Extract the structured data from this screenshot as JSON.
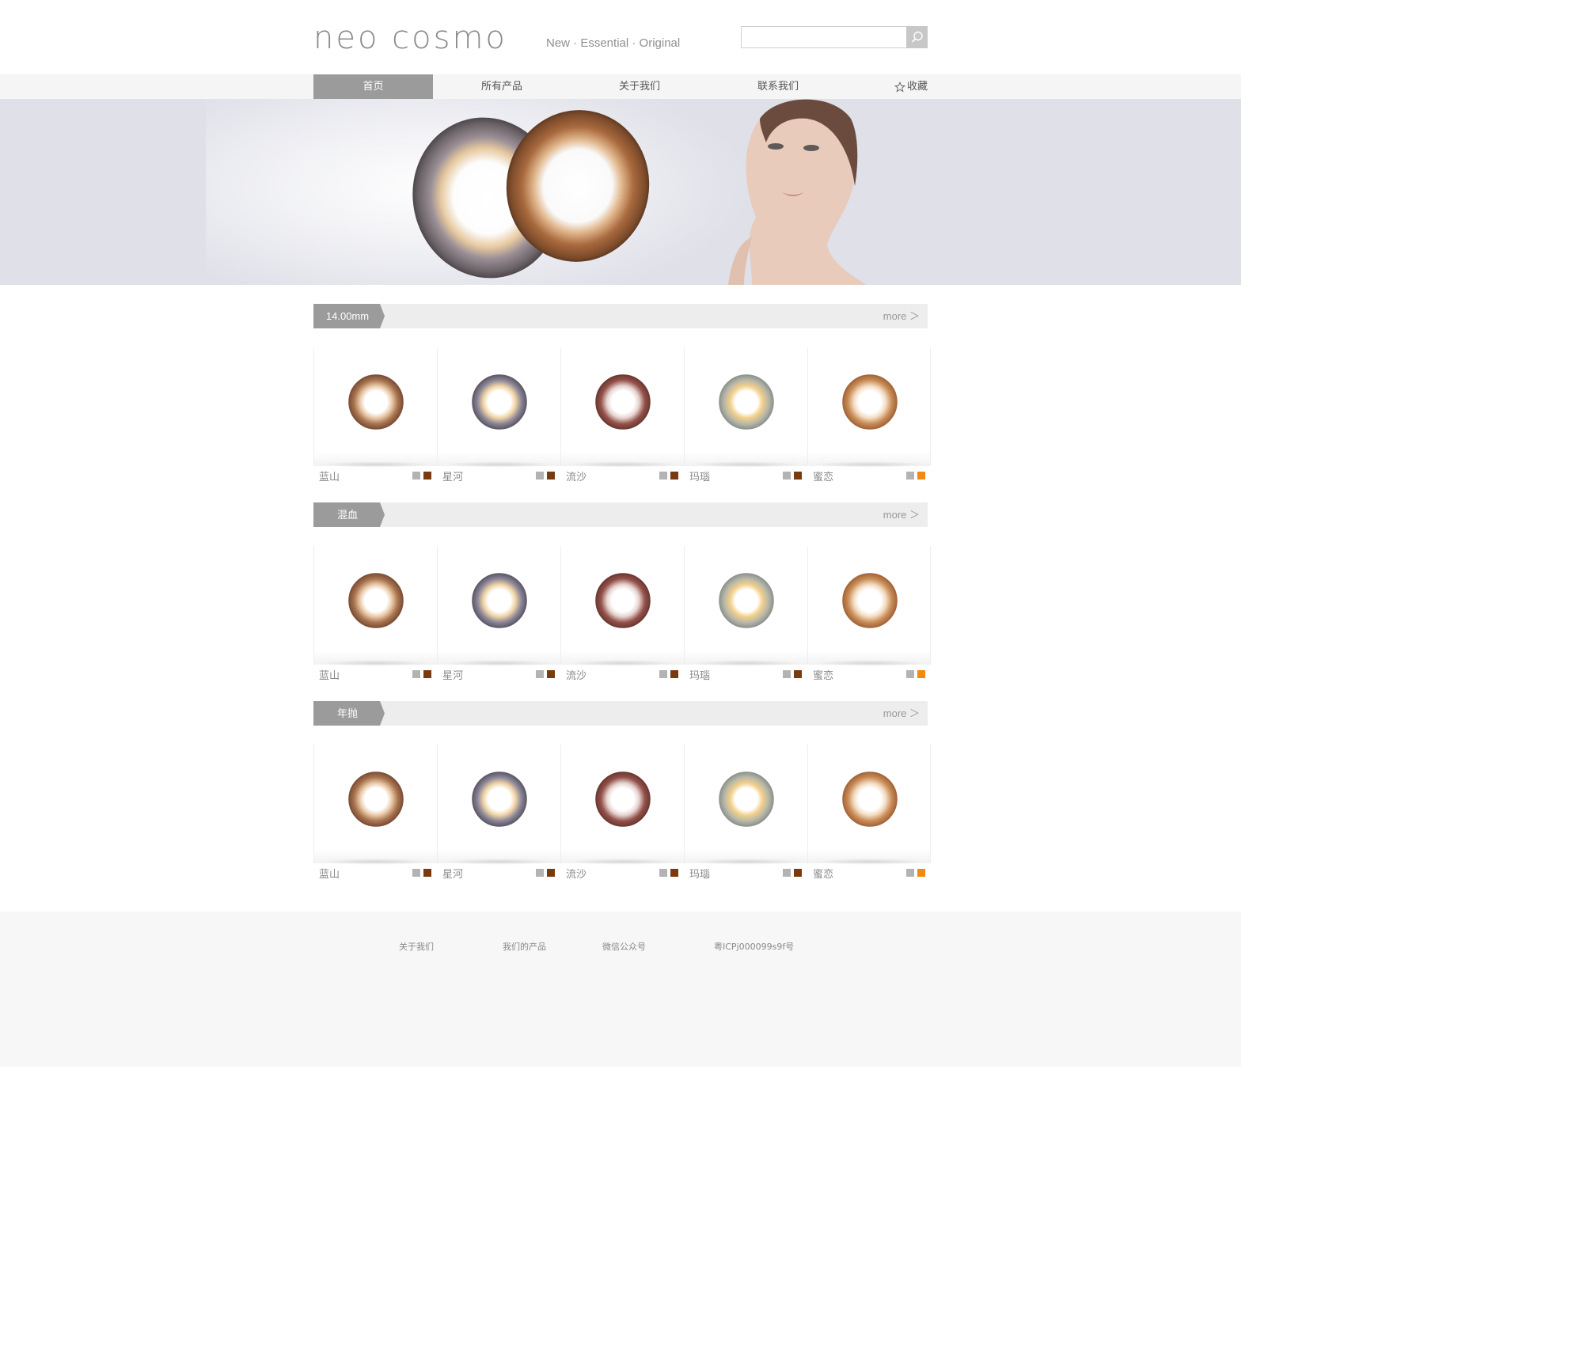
{
  "header": {
    "logo": "neo cosmo",
    "tagline": "New · Essential · Original",
    "search": {
      "value": "",
      "placeholder": ""
    }
  },
  "nav": {
    "items": [
      {
        "label": "首页",
        "active": true
      },
      {
        "label": "所有产品",
        "active": false
      },
      {
        "label": "关于我们",
        "active": false
      },
      {
        "label": "联系我们",
        "active": false
      }
    ],
    "favorite": "收藏"
  },
  "sections": [
    {
      "title": "14.00mm",
      "more": "more ＞",
      "products": [
        {
          "name": "蓝山",
          "swatches": [
            "#b3b3b3",
            "#7a3a10"
          ],
          "lens": "brown"
        },
        {
          "name": "星河",
          "swatches": [
            "#b3b3b3",
            "#7a3a10"
          ],
          "lens": "gray"
        },
        {
          "name": "流沙",
          "swatches": [
            "#b3b3b3",
            "#7a3a10"
          ],
          "lens": "darkbrown"
        },
        {
          "name": "玛瑙",
          "swatches": [
            "#b3b3b3",
            "#7a3a10"
          ],
          "lens": "hazel"
        },
        {
          "name": "蜜恋",
          "swatches": [
            "#b3b3b3",
            "#f08a10"
          ],
          "lens": "honey"
        }
      ]
    },
    {
      "title": "混血",
      "more": "more ＞",
      "products": [
        {
          "name": "蓝山",
          "swatches": [
            "#b3b3b3",
            "#7a3a10"
          ],
          "lens": "brown"
        },
        {
          "name": "星河",
          "swatches": [
            "#b3b3b3",
            "#7a3a10"
          ],
          "lens": "gray"
        },
        {
          "name": "流沙",
          "swatches": [
            "#b3b3b3",
            "#7a3a10"
          ],
          "lens": "darkbrown"
        },
        {
          "name": "玛瑙",
          "swatches": [
            "#b3b3b3",
            "#7a3a10"
          ],
          "lens": "hazel"
        },
        {
          "name": "蜜恋",
          "swatches": [
            "#b3b3b3",
            "#f08a10"
          ],
          "lens": "honey"
        }
      ]
    },
    {
      "title": "年抛",
      "more": "more ＞",
      "products": [
        {
          "name": "蓝山",
          "swatches": [
            "#b3b3b3",
            "#7a3a10"
          ],
          "lens": "brown"
        },
        {
          "name": "星河",
          "swatches": [
            "#b3b3b3",
            "#7a3a10"
          ],
          "lens": "gray"
        },
        {
          "name": "流沙",
          "swatches": [
            "#b3b3b3",
            "#7a3a10"
          ],
          "lens": "darkbrown"
        },
        {
          "name": "玛瑙",
          "swatches": [
            "#b3b3b3",
            "#7a3a10"
          ],
          "lens": "hazel"
        },
        {
          "name": "蜜恋",
          "swatches": [
            "#b3b3b3",
            "#f08a10"
          ],
          "lens": "honey"
        }
      ]
    }
  ],
  "footer": {
    "links": [
      "关于我们",
      "我们的产品",
      "微信公众号",
      "粤ICPj000099s9f号"
    ]
  },
  "colors": {
    "accent": "#9b9b9b",
    "section_bar": "#ededed",
    "nav_bg": "#f5f5f5",
    "banner_bg": "#dfe0e8",
    "footer_bg": "#f7f7f7"
  },
  "icons": {
    "search": "search-icon",
    "favorite": "star-outline-icon",
    "banner": "banner-lens-pair-image",
    "model": "banner-model-image"
  }
}
